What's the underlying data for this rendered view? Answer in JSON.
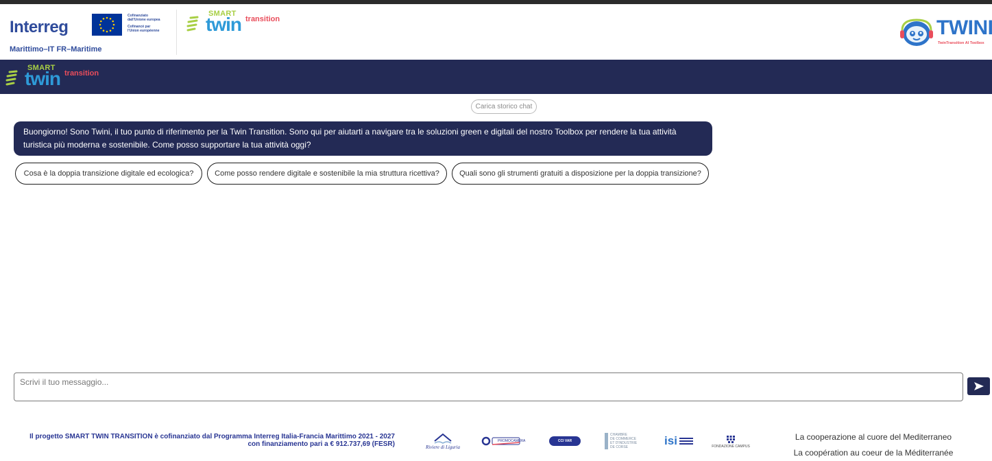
{
  "header": {
    "interreg_word": "Interreg",
    "eu_text": [
      "Cofinanziato",
      "dall'Unione europea",
      "Cofinancé par",
      "l'Union européenne"
    ],
    "programme": "Marittimo–IT FR–Maritime",
    "smart_logo": {
      "smart": "SMART",
      "twin": "twin",
      "transition": "transition"
    },
    "twini_logo": {
      "word": "TWINI",
      "subtitle": "TwinTransition AI Toolbox"
    }
  },
  "nav": {
    "smart_logo": {
      "smart": "SMART",
      "twin": "twin",
      "transition": "transition"
    }
  },
  "chat": {
    "load_history_label": "Carica storico chat",
    "bot_message": "Buongiorno! Sono Twini, il tuo punto di riferimento per la Twin Transition. Sono qui per aiutarti a navigare tra le soluzioni green e digitali del nostro Toolbox per rendere la tua attività turistica più moderna e sostenibile. Come posso supportare la tua attività oggi?",
    "suggestions": [
      "Cosa è la doppia transizione digitale ed ecologica?",
      "Come posso rendere digitale e sostenibile la mia struttura ricettiva?",
      "Quali sono gli strumenti gratuiti a disposizione per la doppia transizione?"
    ],
    "input_placeholder": "Scrivi il tuo messaggio..."
  },
  "footer": {
    "funding_line1": "Il progetto SMART TWIN TRANSITION è cofinanziato dal Programma Interreg Italia-Francia Marittimo 2021 - 2027",
    "funding_line2": "con finanziamento pari a € 912.737,69 (FESR)",
    "partners": {
      "riviere": "Riviere di Liguria",
      "promocamera": "PROMOCAMERA",
      "cci": "CCI VAR",
      "chambre": [
        "CHAMBRE",
        "DE COMMERCE",
        "ET D'INDUSTRIE",
        "DE CORSE"
      ],
      "isi": "isi",
      "campus": "FONDAZIONE CAMPUS"
    },
    "coop_it": "La cooperazione al cuore del Mediterraneo",
    "coop_fr": "La coopération au coeur de la Méditerranée"
  },
  "colors": {
    "navy": "#232a55",
    "interreg_blue": "#2f4b9b",
    "twin_blue": "#2e9ad8",
    "smart_green": "#a8cf45",
    "transition_red": "#e94d5b",
    "eu_blue": "#003399",
    "eu_yellow": "#ffcc00"
  },
  "icons": {
    "send": "send-arrow-icon",
    "flag": "eu-flag-icon",
    "mascot": "robot-headset-icon"
  }
}
